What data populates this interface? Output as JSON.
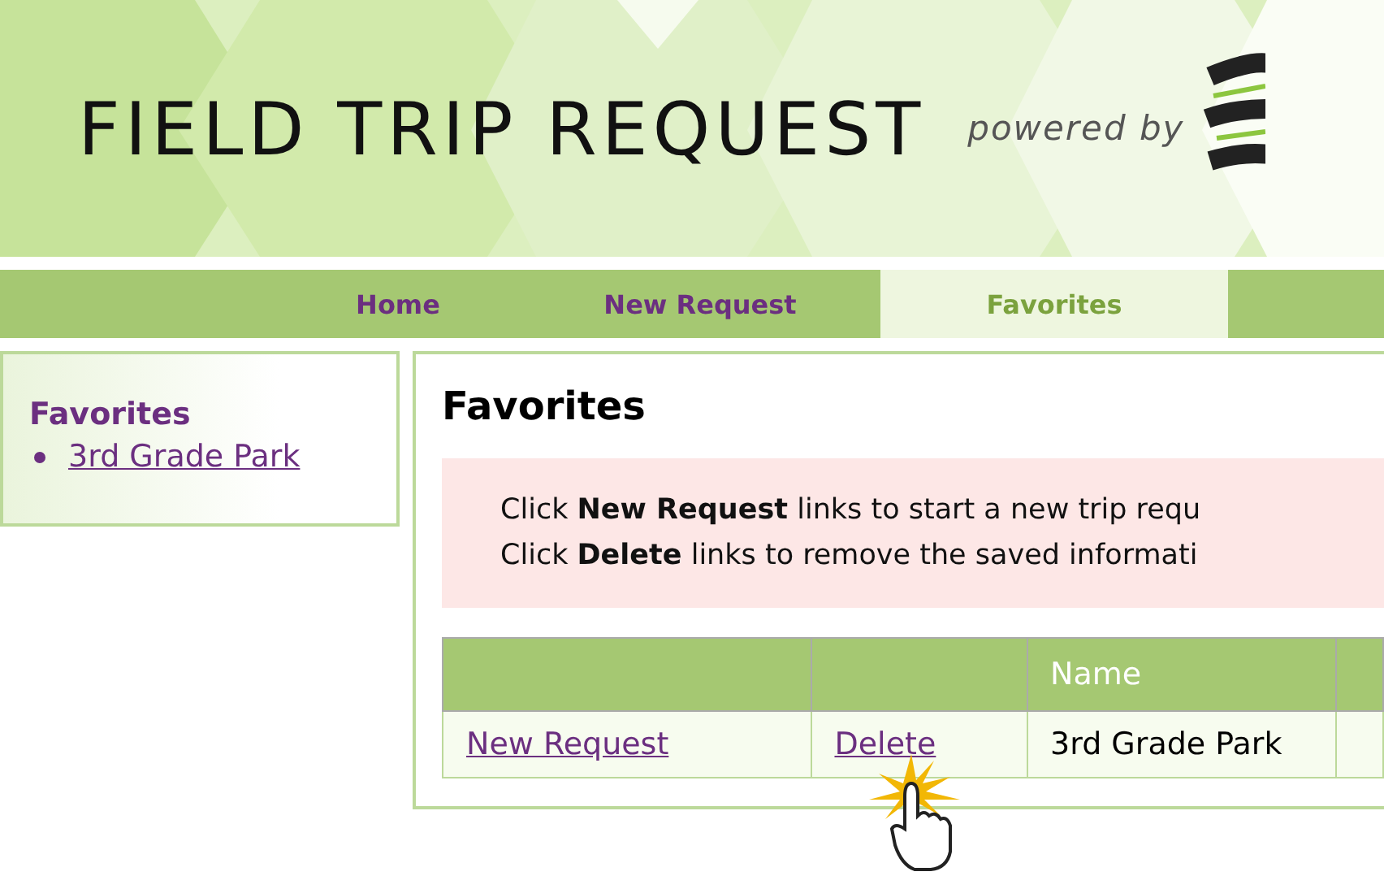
{
  "header": {
    "title": "FIELD TRIP REQUEST",
    "tagline": "powered by"
  },
  "nav": [
    {
      "label": "Home",
      "selected": false
    },
    {
      "label": "New Request",
      "selected": false
    },
    {
      "label": "Favorites",
      "selected": true
    }
  ],
  "sidebar": {
    "title": "Favorites",
    "items": [
      "3rd Grade Park"
    ]
  },
  "main": {
    "title": "Favorites",
    "notice": [
      "Click **New Request** links to start a new trip requ",
      "Click **Delete** links to remove the saved informati"
    ],
    "table": {
      "columns": [
        "",
        "",
        "Name"
      ],
      "rows": [
        {
          "new_request": "New Request",
          "delete": "Delete",
          "name": "3rd Grade Park"
        }
      ]
    }
  }
}
